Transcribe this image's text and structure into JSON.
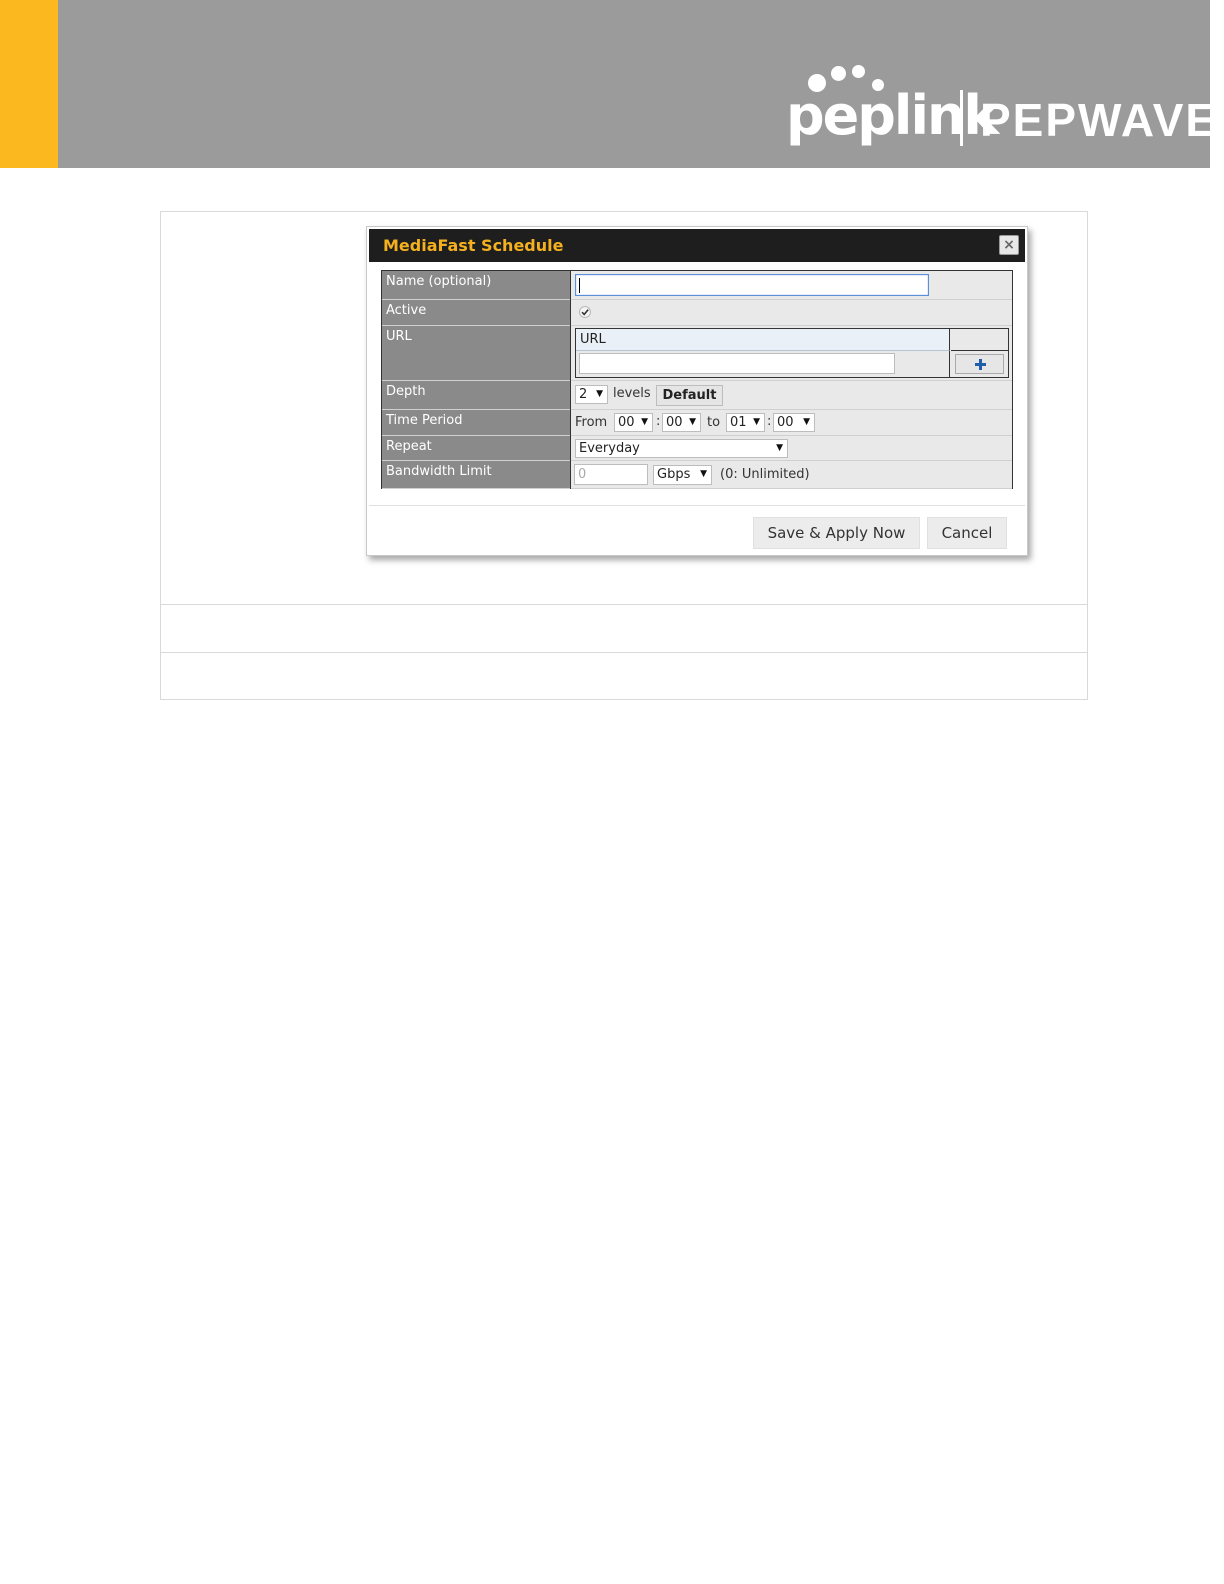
{
  "brand": {
    "name": "peplink",
    "product": "PEPWAVE",
    "banner_color": "#9b9b9b",
    "accent_color": "#fbb91f"
  },
  "dialog": {
    "title": "MediaFast Schedule",
    "title_color": "#f4b01f",
    "close_icon": "close-icon",
    "fields": {
      "name": {
        "label": "Name (optional)",
        "value": ""
      },
      "active": {
        "label": "Active",
        "checked": true
      },
      "url": {
        "label": "URL",
        "column_header": "URL",
        "value": "",
        "add_icon": "plus-icon"
      },
      "depth": {
        "label": "Depth",
        "value": "2",
        "suffix": "levels",
        "default_button": "Default"
      },
      "time_period": {
        "label": "Time Period",
        "from_label": "From",
        "from_hour": "00",
        "from_min": "00",
        "colon": ":",
        "to_label": "to",
        "to_hour": "01",
        "to_min": "00"
      },
      "repeat": {
        "label": "Repeat",
        "value": "Everyday"
      },
      "bandwidth": {
        "label": "Bandwidth Limit",
        "value": "0",
        "unit": "Gbps",
        "hint": "(0: Unlimited)"
      }
    },
    "buttons": {
      "save": "Save & Apply Now",
      "cancel": "Cancel"
    }
  }
}
